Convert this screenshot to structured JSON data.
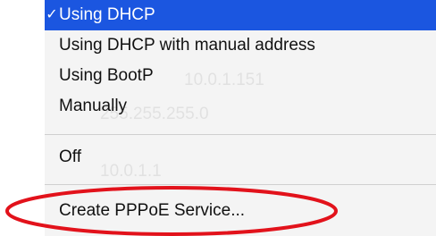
{
  "menu": {
    "items": [
      {
        "label": "Using DHCP",
        "checked": true,
        "check_glyph": "✓"
      },
      {
        "label": "Using DHCP with manual address"
      },
      {
        "label": "Using BootP"
      },
      {
        "label": "Manually"
      },
      {
        "label": "Off"
      },
      {
        "label": "Create PPPoE Service..."
      }
    ],
    "selected_color": "#1b56e0",
    "background_color": "#f4f4f4"
  },
  "background_ghost_text": {
    "line1": "10.0.1.151",
    "line2": "255.255.255.0",
    "line3": "10.0.1.1"
  },
  "annotation": {
    "type": "red-ellipse",
    "color": "#e2121b",
    "target": "Create PPPoE Service..."
  }
}
